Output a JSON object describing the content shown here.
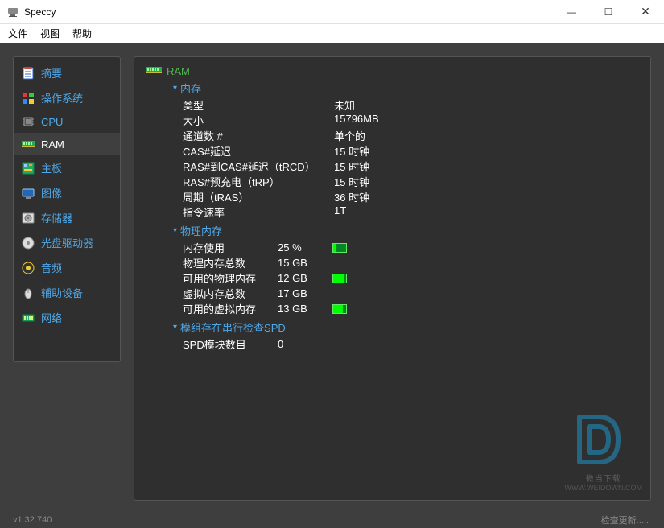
{
  "window": {
    "title": "Speccy"
  },
  "menu": {
    "file": "文件",
    "view": "视图",
    "help": "帮助"
  },
  "sidebar": {
    "items": [
      {
        "label": "摘要",
        "id": "summary"
      },
      {
        "label": "操作系统",
        "id": "os"
      },
      {
        "label": "CPU",
        "id": "cpu"
      },
      {
        "label": "RAM",
        "id": "ram"
      },
      {
        "label": "主板",
        "id": "mobo"
      },
      {
        "label": "图像",
        "id": "graphics"
      },
      {
        "label": "存储器",
        "id": "storage"
      },
      {
        "label": "光盘驱动器",
        "id": "optical"
      },
      {
        "label": "音频",
        "id": "audio"
      },
      {
        "label": "辅助设备",
        "id": "peripherals"
      },
      {
        "label": "网络",
        "id": "network"
      }
    ]
  },
  "ram": {
    "header": "RAM",
    "memory": {
      "title": "内存",
      "rows": [
        {
          "k": "类型",
          "v": "未知"
        },
        {
          "k": "大小",
          "v": "15796MB"
        },
        {
          "k": "通道数 #",
          "v": "单个的"
        },
        {
          "k": "CAS#延迟",
          "v": "15 时钟"
        },
        {
          "k": "RAS#到CAS#延迟（tRCD）",
          "v": "15 时钟"
        },
        {
          "k": "RAS#预充电（tRP）",
          "v": "15 时钟"
        },
        {
          "k": "周期（tRAS）",
          "v": "36 时钟"
        },
        {
          "k": "指令速率",
          "v": "1T"
        }
      ]
    },
    "physical": {
      "title": "物理内存",
      "rows": [
        {
          "k": "内存使用",
          "v": "25 %",
          "bar": 25
        },
        {
          "k": "物理内存总数",
          "v": "15 GB"
        },
        {
          "k": "可用的物理内存",
          "v": "12 GB",
          "bar": 80
        },
        {
          "k": "虚拟内存总数",
          "v": "17 GB"
        },
        {
          "k": "可用的虚拟内存",
          "v": "13 GB",
          "bar": 76
        }
      ]
    },
    "spd": {
      "title": "模组存在串行检查SPD",
      "k": "SPD模块数目",
      "v": "0"
    }
  },
  "status": {
    "version": "v1.32.740",
    "update": "检查更新......"
  },
  "watermark": {
    "text": "微当下载",
    "url": "WWW.WEIDOWN.COM"
  }
}
